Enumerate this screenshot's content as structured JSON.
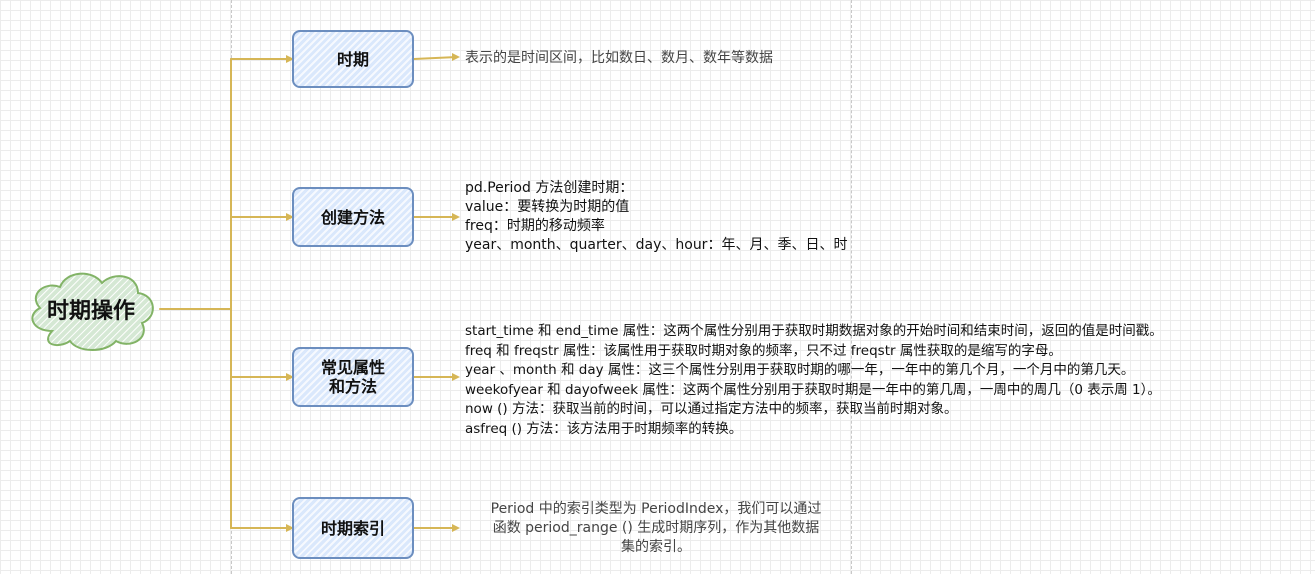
{
  "root": {
    "label": "时期操作"
  },
  "branches": [
    {
      "label": "时期",
      "description": [
        "表示的是时间区间，比如数日、数月、数年等数据"
      ]
    },
    {
      "label": "创建方法",
      "description": [
        "pd.Period 方法创建时期：",
        "value：要转换为时期的值",
        "freq：时期的移动频率",
        "year、month、quarter、day、hour：年、月、季、日、时"
      ]
    },
    {
      "label_lines": [
        "常见属性",
        "和方法"
      ],
      "description": [
        "start_time 和 end_time 属性：这两个属性分别用于获取时期数据对象的开始时间和结束时间，返回的值是时间戳。",
        "freq 和 freqstr 属性：该属性用于获取时期对象的频率，只不过 freqstr 属性获取的是缩写的字母。",
        "year 、month 和 day 属性：这三个属性分别用于获取时期的哪一年，一年中的第几个月，一个月中的第几天。",
        "weekofyear 和 dayofweek 属性：这两个属性分别用于获取时期是一年中的第几周，一周中的周几（0 表示周 1）。",
        "now () 方法：获取当前的时间，可以通过指定方法中的频率，获取当前时期对象。",
        "asfreq () 方法：该方法用于时期频率的转换。"
      ]
    },
    {
      "label": "时期索引",
      "description": [
        "Period 中的索引类型为 PeriodIndex，我们可以通过",
        "函数 period_range () 生成时期序列，作为其他数据",
        "集的索引。"
      ]
    }
  ],
  "colors": {
    "connector": "#d6b656",
    "node_fill": "#dae8fc",
    "node_border": "#6c8ebf",
    "cloud_fill": "#d5e8d4",
    "cloud_border": "#82b366"
  }
}
